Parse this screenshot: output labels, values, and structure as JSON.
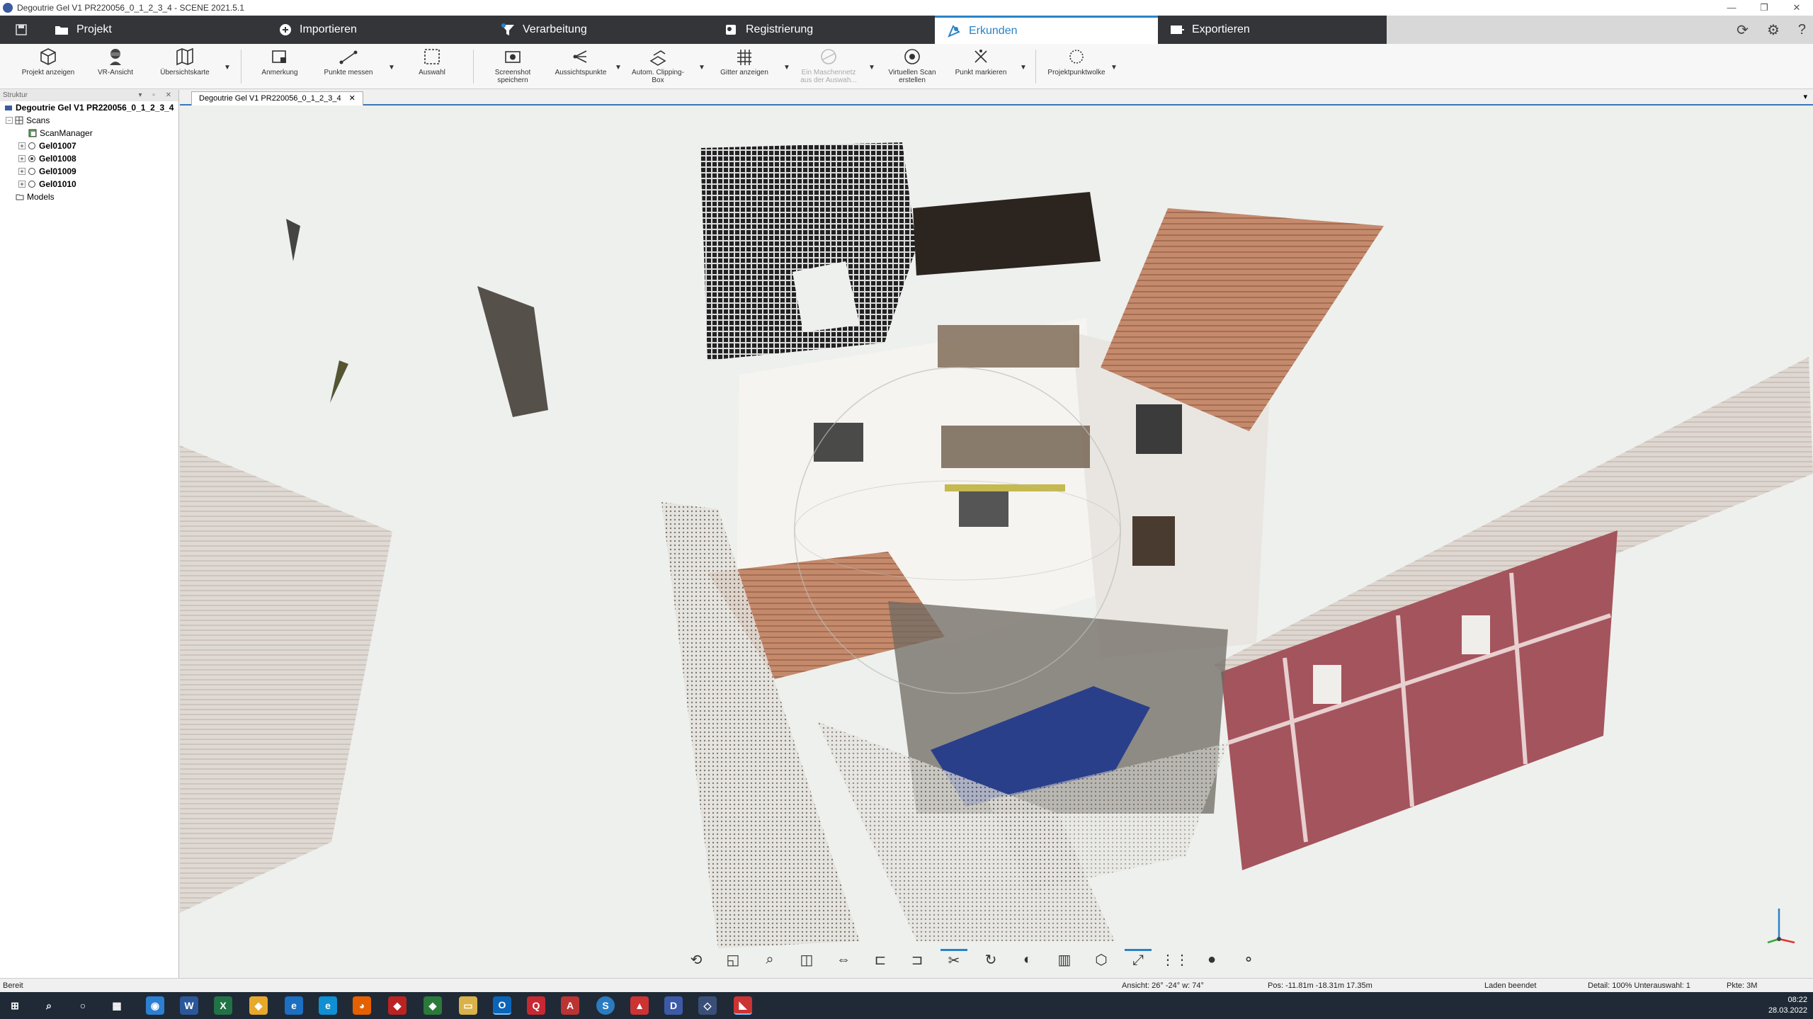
{
  "window": {
    "title": "Degoutrie Gel V1 PR220056_0_1_2_3_4 - SCENE 2021.5.1",
    "controls": [
      "—",
      "❐",
      "✕"
    ]
  },
  "ribbon": {
    "tabs": [
      {
        "label": "Projekt",
        "icon": "folder-icon",
        "active": false
      },
      {
        "label": "Importieren",
        "icon": "import-icon",
        "active": false
      },
      {
        "label": "Verarbeitung",
        "icon": "filter-icon",
        "active": false
      },
      {
        "label": "Registrierung",
        "icon": "registration-icon",
        "active": false
      },
      {
        "label": "Erkunden",
        "icon": "explore-icon",
        "active": true
      },
      {
        "label": "Exportieren",
        "icon": "export-icon",
        "active": false
      }
    ],
    "accent": "#2b83c6",
    "dark": "#333539"
  },
  "toolbar": {
    "projekt_anzeigen": "Projekt anzeigen",
    "vr_ansicht": "VR-Ansicht",
    "uebersichtskarte": "Übersichtskarte",
    "anmerkung": "Anmerkung",
    "punkte_messen": "Punkte messen",
    "auswahl": "Auswahl",
    "screenshot_1": "Screenshot",
    "screenshot_2": "speichern",
    "aussichtspunkte": "Aussichtspunkte",
    "clipping_1": "Autom. Clipping-",
    "clipping_2": "Box",
    "gitter": "Gitter anzeigen",
    "maschennetz_1": "Ein Maschennetz",
    "maschennetz_2": "aus der Auswah...",
    "virtuell_1": "Virtuellen Scan",
    "virtuell_2": "erstellen",
    "punkt_markieren": "Punkt markieren",
    "projektpunktwolke": "Projektpunktwolke"
  },
  "structure": {
    "header": "Struktur",
    "header_controls": "▾ ▫ ✕",
    "root": "Degoutrie Gel V1 PR220056_0_1_2_3_4",
    "scans": "Scans",
    "scanmanager": "ScanManager",
    "items": [
      "Gel01007",
      "Gel01008",
      "Gel01009",
      "Gel01010"
    ],
    "models": "Models"
  },
  "document": {
    "tab": "Degoutrie Gel V1 PR220056_0_1_2_3_4",
    "close": "✕",
    "menu": "▾"
  },
  "status": {
    "ready": "Bereit",
    "view": "Ansicht: 26° -24° w: 74°",
    "pos": "Pos: -11.81m -18.31m 17.35m",
    "loading": "Laden beendet",
    "detail": "Detail: 100%  Unterauswahl:  1",
    "points": "Pkte:  3M"
  },
  "taskbar": {
    "time": "08:22",
    "date": "28.03.2022"
  }
}
